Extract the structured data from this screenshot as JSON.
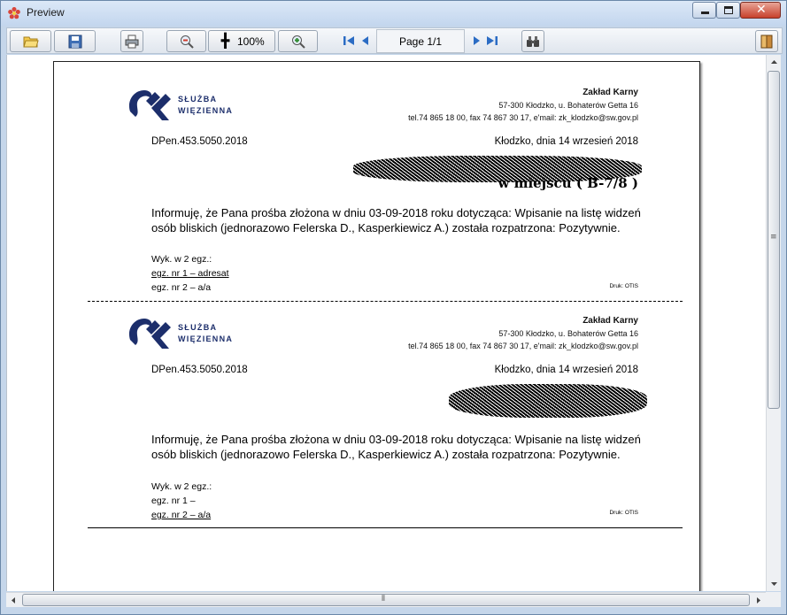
{
  "window": {
    "title": "Preview"
  },
  "toolbar": {
    "zoom_label": "100%",
    "page_indicator": "Page 1/1"
  },
  "document": {
    "sections": [
      {
        "logo_line1": "SŁUŻBA",
        "logo_line2": "WIĘZIENNA",
        "org_name": "Zakład Karny",
        "org_address": "57-300 Kłodzko, u. Bohaterów Getta 16",
        "org_contact": "tel.74 865 18 00, fax 74 867 30 17, e'mail: zk_klodzko@sw.gov.pl",
        "doc_ref": "DPen.453.5050.2018",
        "place_date": "Kłodzko, dnia 14 wrzesień 2018",
        "in_place": "w miejscu ( B-7/8 )",
        "body": "Informuję, że Pana prośba złożona w dniu 03-09-2018 roku dotycząca: Wpisanie na listę widzeń osób bliskich (jednorazowo Felerska D., Kasperkiewicz A.) została rozpatrzona: Pozytywnie.",
        "copies_title": "Wyk. w 2 egz.:",
        "copy1": "egz. nr 1 – adresat",
        "copy2": "egz. nr 2 – a/a",
        "druk": "Druk: OTIS"
      },
      {
        "logo_line1": "SŁUŻBA",
        "logo_line2": "WIĘZIENNA",
        "org_name": "Zakład Karny",
        "org_address": "57-300 Kłodzko, u. Bohaterów Getta 16",
        "org_contact": "tel.74 865 18 00, fax 74 867 30 17, e'mail: zk_klodzko@sw.gov.pl",
        "doc_ref": "DPen.453.5050.2018",
        "place_date": "Kłodzko, dnia 14 wrzesień 2018",
        "body": "Informuję, że Pana prośba złożona w dniu 03-09-2018 roku dotycząca: Wpisanie na listę widzeń osób bliskich (jednorazowo Felerska D., Kasperkiewicz A.) została rozpatrzona: Pozytywnie.",
        "copies_title": "Wyk. w 2 egz.:",
        "copy1": "egz. nr 1 –",
        "copy2": "egz. nr 2 – a/a",
        "druk": "Druk: OTIS"
      }
    ]
  },
  "colors": {
    "logo_blue": "#1c2e6b",
    "titlebar": "#c3d6ee",
    "close_button": "#c7402b"
  },
  "icons": [
    "app-flower-icon",
    "open-icon",
    "save-icon",
    "print-icon",
    "zoom-out-icon",
    "zoom-fit-icon",
    "zoom-in-icon",
    "first-page-icon",
    "prev-page-icon",
    "next-page-icon",
    "last-page-icon",
    "binoculars-icon",
    "exit-icon"
  ]
}
